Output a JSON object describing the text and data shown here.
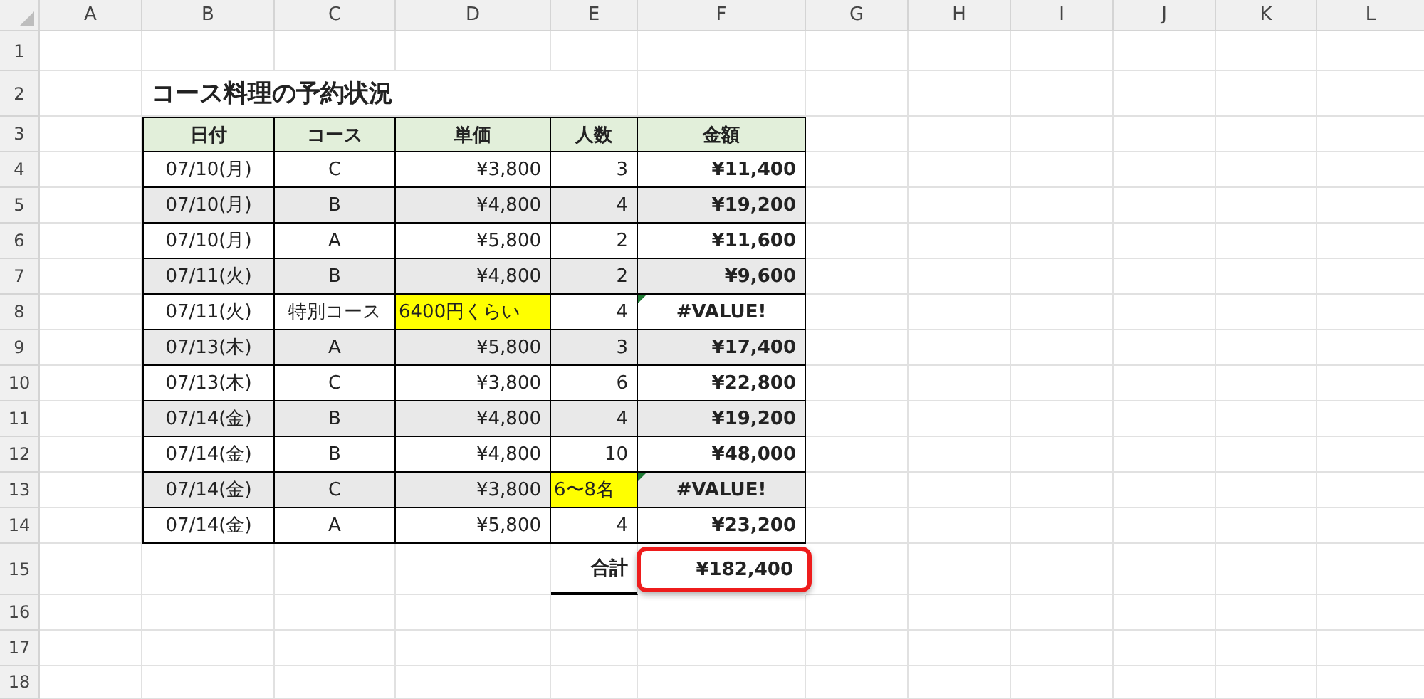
{
  "columns": [
    "A",
    "B",
    "C",
    "D",
    "E",
    "F",
    "G",
    "H",
    "I",
    "J",
    "K",
    "L"
  ],
  "row_numbers": [
    "1",
    "2",
    "3",
    "4",
    "5",
    "6",
    "7",
    "8",
    "9",
    "10",
    "11",
    "12",
    "13",
    "14",
    "15",
    "16",
    "17",
    "18"
  ],
  "title": "コース料理の予約状況",
  "table": {
    "headers": [
      "日付",
      "コース",
      "単価",
      "人数",
      "金額"
    ],
    "rows": [
      {
        "cells": [
          {
            "text": "07/10(月)",
            "highlighted": false
          },
          {
            "text": "C",
            "highlighted": false
          },
          {
            "text": "¥3,800",
            "highlighted": false
          },
          {
            "text": "3",
            "highlighted": false
          },
          {
            "text": "¥11,400",
            "highlighted": false
          }
        ],
        "shaded": false,
        "error_flag": false
      },
      {
        "cells": [
          {
            "text": "07/10(月)",
            "highlighted": false
          },
          {
            "text": "B",
            "highlighted": false
          },
          {
            "text": "¥4,800",
            "highlighted": false
          },
          {
            "text": "4",
            "highlighted": false
          },
          {
            "text": "¥19,200",
            "highlighted": false
          }
        ],
        "shaded": true,
        "error_flag": false
      },
      {
        "cells": [
          {
            "text": "07/10(月)",
            "highlighted": false
          },
          {
            "text": "A",
            "highlighted": false
          },
          {
            "text": "¥5,800",
            "highlighted": false
          },
          {
            "text": "2",
            "highlighted": false
          },
          {
            "text": "¥11,600",
            "highlighted": false
          }
        ],
        "shaded": false,
        "error_flag": false
      },
      {
        "cells": [
          {
            "text": "07/11(火)",
            "highlighted": false
          },
          {
            "text": "B",
            "highlighted": false
          },
          {
            "text": "¥4,800",
            "highlighted": false
          },
          {
            "text": "2",
            "highlighted": false
          },
          {
            "text": "¥9,600",
            "highlighted": false
          }
        ],
        "shaded": true,
        "error_flag": false
      },
      {
        "cells": [
          {
            "text": "07/11(火)",
            "highlighted": false
          },
          {
            "text": "特別コース",
            "highlighted": false
          },
          {
            "text": "6400円くらい",
            "highlighted": true
          },
          {
            "text": "4",
            "highlighted": false
          },
          {
            "text": "#VALUE!",
            "highlighted": false
          }
        ],
        "shaded": false,
        "error_flag": true
      },
      {
        "cells": [
          {
            "text": "07/13(木)",
            "highlighted": false
          },
          {
            "text": "A",
            "highlighted": false
          },
          {
            "text": "¥5,800",
            "highlighted": false
          },
          {
            "text": "3",
            "highlighted": false
          },
          {
            "text": "¥17,400",
            "highlighted": false
          }
        ],
        "shaded": true,
        "error_flag": false
      },
      {
        "cells": [
          {
            "text": "07/13(木)",
            "highlighted": false
          },
          {
            "text": "C",
            "highlighted": false
          },
          {
            "text": "¥3,800",
            "highlighted": false
          },
          {
            "text": "6",
            "highlighted": false
          },
          {
            "text": "¥22,800",
            "highlighted": false
          }
        ],
        "shaded": false,
        "error_flag": false
      },
      {
        "cells": [
          {
            "text": "07/14(金)",
            "highlighted": false
          },
          {
            "text": "B",
            "highlighted": false
          },
          {
            "text": "¥4,800",
            "highlighted": false
          },
          {
            "text": "4",
            "highlighted": false
          },
          {
            "text": "¥19,200",
            "highlighted": false
          }
        ],
        "shaded": true,
        "error_flag": false
      },
      {
        "cells": [
          {
            "text": "07/14(金)",
            "highlighted": false
          },
          {
            "text": "B",
            "highlighted": false
          },
          {
            "text": "¥4,800",
            "highlighted": false
          },
          {
            "text": "10",
            "highlighted": false
          },
          {
            "text": "¥48,000",
            "highlighted": false
          }
        ],
        "shaded": false,
        "error_flag": false
      },
      {
        "cells": [
          {
            "text": "07/14(金)",
            "highlighted": false
          },
          {
            "text": "C",
            "highlighted": false
          },
          {
            "text": "¥3,800",
            "highlighted": false
          },
          {
            "text": "6〜8名",
            "highlighted": true
          },
          {
            "text": "#VALUE!",
            "highlighted": false
          }
        ],
        "shaded": true,
        "error_flag": true
      },
      {
        "cells": [
          {
            "text": "07/14(金)",
            "highlighted": false
          },
          {
            "text": "A",
            "highlighted": false
          },
          {
            "text": "¥5,800",
            "highlighted": false
          },
          {
            "text": "4",
            "highlighted": false
          },
          {
            "text": "¥23,200",
            "highlighted": false
          }
        ],
        "shaded": false,
        "error_flag": false
      }
    ]
  },
  "total": {
    "label": "合計",
    "value": "¥182,400",
    "circled": true
  }
}
